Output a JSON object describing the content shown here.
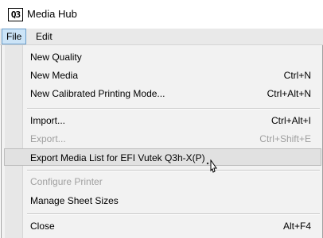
{
  "window": {
    "app_icon_text": "Q3",
    "title": "Media Hub"
  },
  "menubar": {
    "items": [
      {
        "label": "File",
        "active": true
      },
      {
        "label": "Edit",
        "active": false
      }
    ]
  },
  "file_menu": {
    "items": [
      {
        "label": "New Quality",
        "shortcut": "",
        "disabled": false
      },
      {
        "label": "New Media",
        "shortcut": "Ctrl+N",
        "disabled": false
      },
      {
        "label": "New Calibrated Printing Mode...",
        "shortcut": "Ctrl+Alt+N",
        "disabled": false
      },
      {
        "label": "Import...",
        "shortcut": "Ctrl+Alt+I",
        "disabled": false
      },
      {
        "label": "Export...",
        "shortcut": "Ctrl+Shift+E",
        "disabled": true
      },
      {
        "label": "Export Media List for EFI Vutek Q3h-X(P)",
        "shortcut": "",
        "disabled": false,
        "highlighted": true
      },
      {
        "label": "Configure Printer",
        "shortcut": "",
        "disabled": true
      },
      {
        "label": "Manage Sheet Sizes",
        "shortcut": "",
        "disabled": false
      },
      {
        "label": "Close",
        "shortcut": "Alt+F4",
        "disabled": false
      }
    ]
  },
  "colors": {
    "menubar_bg": "#e9e9e9",
    "menu_bg": "#f2f2f2",
    "active_menu": "#cce4f7",
    "highlight_row": "#e1e1e1",
    "disabled_text": "#a0a0a0"
  },
  "icons": [
    "app-logo-icon",
    "pointer-cursor-icon"
  ]
}
